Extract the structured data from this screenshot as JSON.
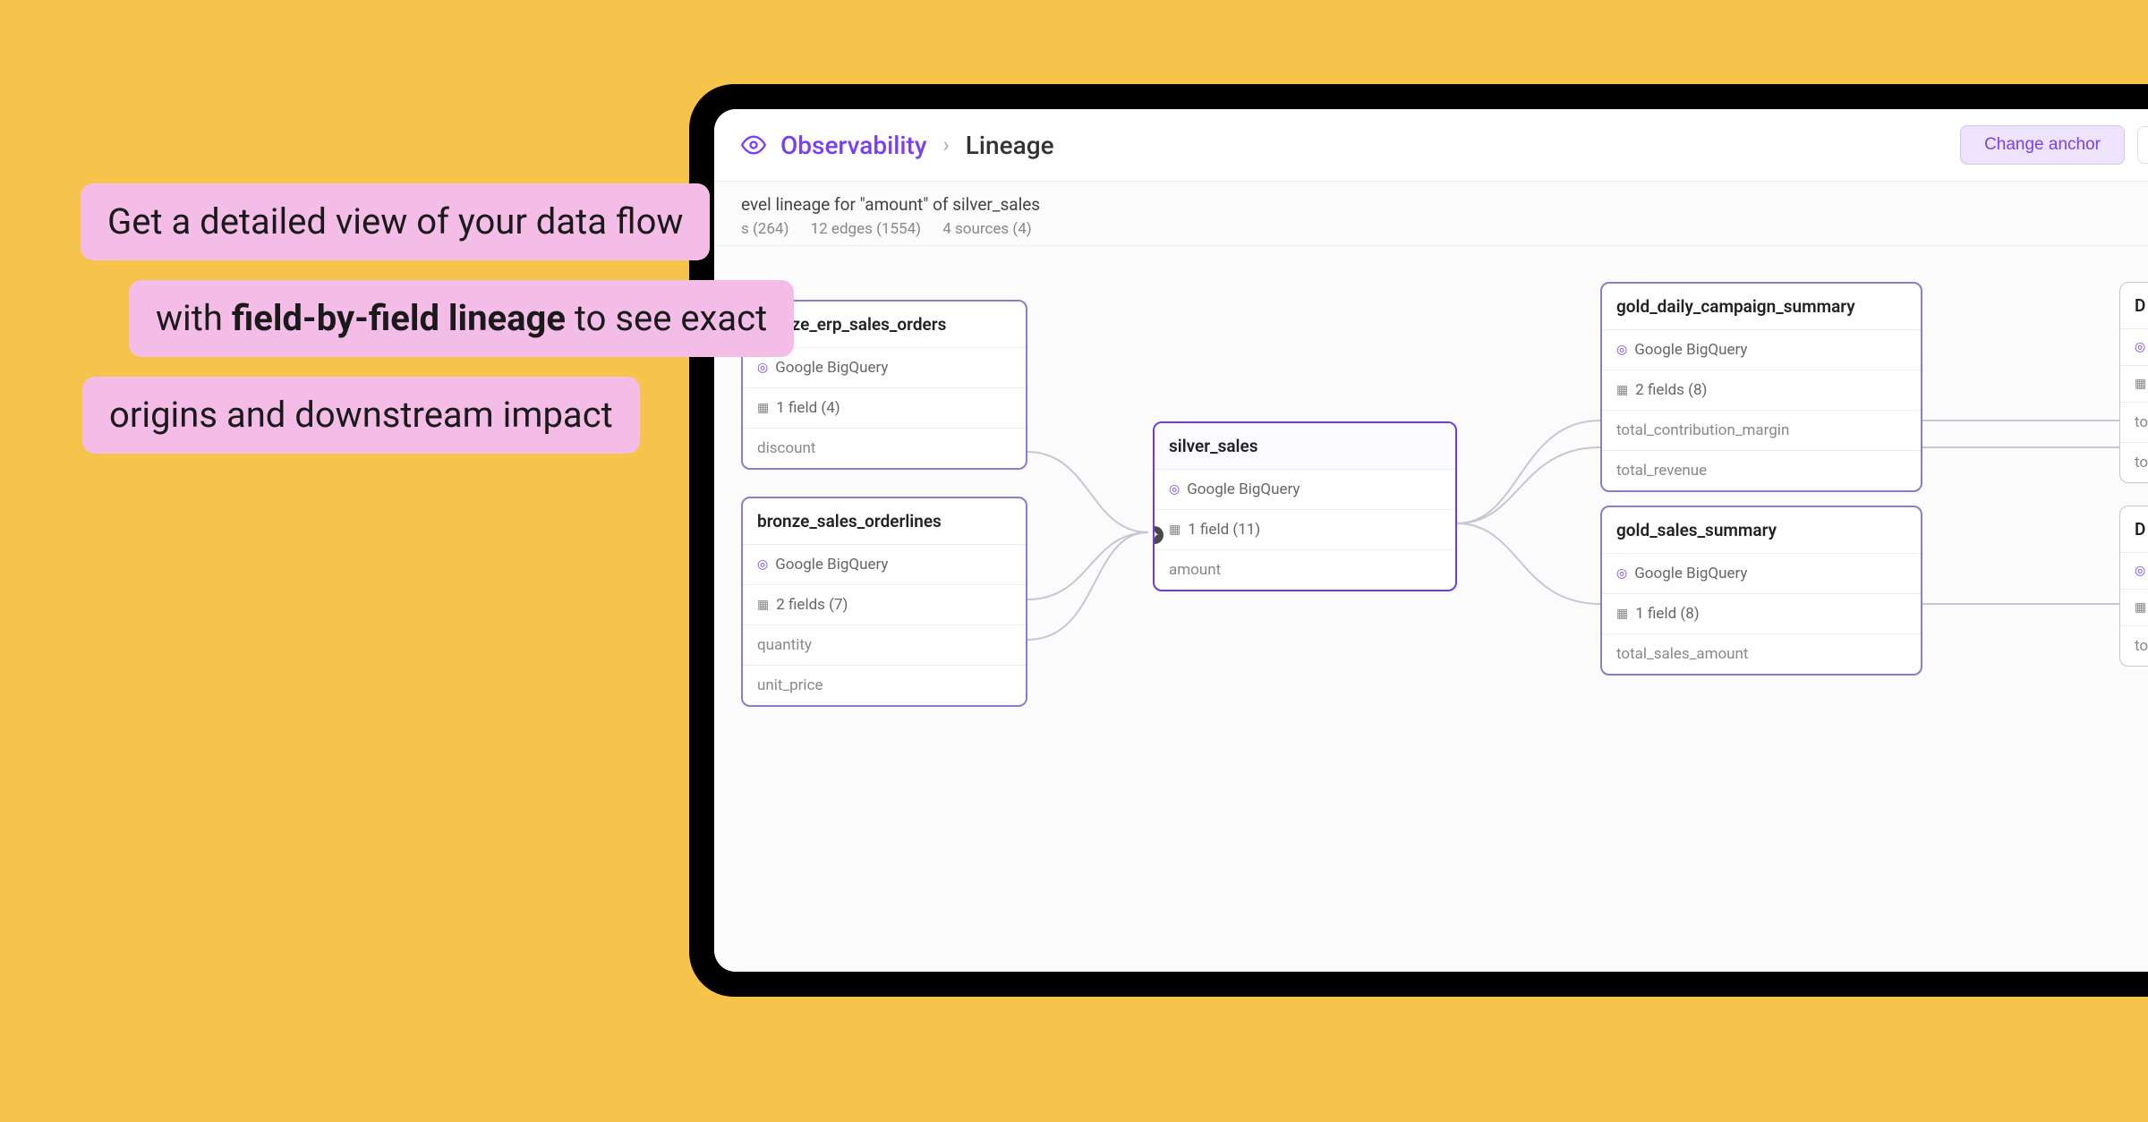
{
  "callouts": {
    "line1": "Get a detailed view of your data flow",
    "line2_pre": "with ",
    "line2_bold": "field-by-field lineage",
    "line2_post": " to see exact",
    "line3": "origins and downstream impact"
  },
  "header": {
    "breadcrumb_root": "Observability",
    "breadcrumb_current": "Lineage",
    "change_anchor_label": "Change anchor"
  },
  "subheader": {
    "title_suffix": "evel lineage for \"amount\" of silver_sales",
    "stat_nodes": "s (264)",
    "stat_edges": "12 edges (1554)",
    "stat_sources": "4 sources (4)"
  },
  "nodes": {
    "bronze_erp": {
      "title": "bronze_erp_sales_orders",
      "source": "Google BigQuery",
      "fields_summary": "1 field (4)",
      "fields": [
        "discount"
      ]
    },
    "bronze_orderlines": {
      "title": "bronze_sales_orderlines",
      "source": "Google BigQuery",
      "fields_summary": "2 fields (7)",
      "fields": [
        "quantity",
        "unit_price"
      ]
    },
    "silver": {
      "title": "silver_sales",
      "source": "Google BigQuery",
      "fields_summary": "1 field (11)",
      "fields": [
        "amount"
      ]
    },
    "gold_campaign": {
      "title": "gold_daily_campaign_summary",
      "source": "Google BigQuery",
      "fields_summary": "2 fields (8)",
      "fields": [
        "total_contribution_margin",
        "total_revenue"
      ]
    },
    "gold_summary": {
      "title": "gold_sales_summary",
      "source": "Google BigQuery",
      "fields_summary": "1 field (8)",
      "fields": [
        "total_sales_amount"
      ]
    },
    "clip1": {
      "title": "D",
      "row1": "",
      "row2": "",
      "field1": "to",
      "field2": "to"
    },
    "clip2": {
      "title": "D",
      "row1": "",
      "row2": "",
      "field1": "to"
    }
  }
}
